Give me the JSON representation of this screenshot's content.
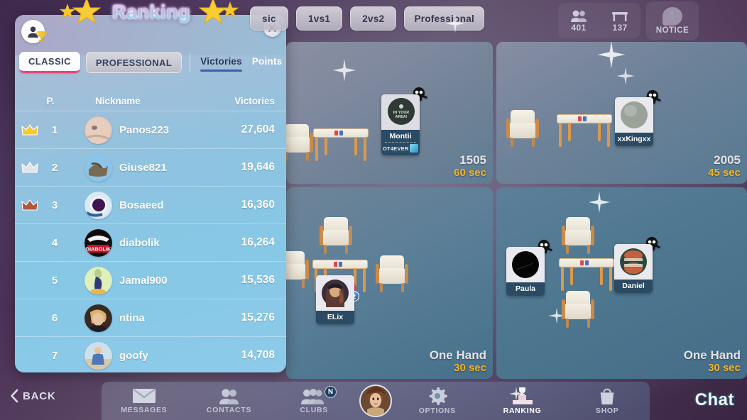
{
  "window": {
    "title": "Ranking"
  },
  "topbar": {
    "filters": [
      {
        "label": "Classic",
        "display": "sic",
        "active": false
      },
      {
        "label": "1vs1",
        "display": "1vs1",
        "active": false
      },
      {
        "label": "2vs2",
        "display": "2vs2",
        "active": false
      },
      {
        "label": "Professional",
        "display": "Professional",
        "active": false
      }
    ],
    "counters": [
      {
        "icon": "players-icon",
        "value": "401"
      },
      {
        "icon": "table-icon",
        "value": "137"
      }
    ],
    "notice": {
      "label": "NOTICE",
      "icon": "speech-bubble-icon"
    }
  },
  "panel": {
    "title": "Ranking",
    "avatar_icon": "user-avatar-icon",
    "trophy_icon": "trophy-icon",
    "close_icon": "close-icon",
    "mode_tabs": [
      {
        "label": "CLASSIC",
        "active": true
      },
      {
        "label": "PROFESSIONAL",
        "active": false
      }
    ],
    "sub_tabs": [
      {
        "label": "Victories",
        "active": true
      },
      {
        "label": "Points",
        "active": false
      }
    ],
    "columns": {
      "position": "P.",
      "nickname": "Nickname",
      "value": "Victories"
    },
    "rows": [
      {
        "crown": "gold-crown-icon",
        "pos": "1",
        "nick": "Panos223",
        "value": "27,604"
      },
      {
        "crown": "silver-crown-icon",
        "pos": "2",
        "nick": "Giuse821",
        "value": "19,646"
      },
      {
        "crown": "bronze-crown-icon",
        "pos": "3",
        "nick": "Bosaeed",
        "value": "16,360"
      },
      {
        "crown": "",
        "pos": "4",
        "nick": "diabolik",
        "value": "16,264"
      },
      {
        "crown": "",
        "pos": "5",
        "nick": "Jamal900",
        "value": "15,536"
      },
      {
        "crown": "",
        "pos": "6",
        "nick": "ntina",
        "value": "15,276"
      },
      {
        "crown": "",
        "pos": "7",
        "nick": "goofy",
        "value": "14,708"
      }
    ]
  },
  "lobby": {
    "tables": [
      {
        "name": "1505",
        "time": "60 sec",
        "players": [
          {
            "nick": "Montii",
            "club": "OT4EVER",
            "skull": true
          }
        ]
      },
      {
        "name": "2005",
        "time": "45 sec",
        "players": [
          {
            "nick": "xxKingxx",
            "club": "",
            "skull": true
          }
        ]
      },
      {
        "name": "One Hand",
        "time": "30 sec",
        "players": [
          {
            "nick": "ELix",
            "club": "",
            "skull": false,
            "seat_badge": "2"
          }
        ]
      },
      {
        "name": "One Hand",
        "time": "30 sec",
        "players": [
          {
            "nick": "Paula",
            "club": "",
            "skull": true
          },
          {
            "nick": "Daniel",
            "club": "",
            "skull": true
          }
        ]
      }
    ]
  },
  "bottomnav": {
    "back_label": "BACK",
    "items": [
      {
        "label": "MESSAGES",
        "icon": "envelope-icon",
        "active": false,
        "badge": ""
      },
      {
        "label": "CONTACTS",
        "icon": "contacts-icon",
        "active": false,
        "badge": ""
      },
      {
        "label": "CLUBS",
        "icon": "clubs-icon",
        "active": false,
        "badge": "N"
      },
      {
        "label": "OPTIONS",
        "icon": "gear-icon",
        "active": false,
        "badge": ""
      },
      {
        "label": "RANKING",
        "icon": "podium-icon",
        "active": true,
        "badge": ""
      },
      {
        "label": "SHOP",
        "icon": "shopping-bag-icon",
        "active": false,
        "badge": ""
      }
    ],
    "chat_label": "Chat",
    "avatar_icon": "user-photo-avatar"
  },
  "colors": {
    "background": "#4a3156",
    "panel_accent": "#86c8e6",
    "active_tab_underline": "#e8457b",
    "subtab_underline": "#3d5fa8",
    "timer_text": "#f0b429",
    "player_card": "#2b4a63"
  }
}
